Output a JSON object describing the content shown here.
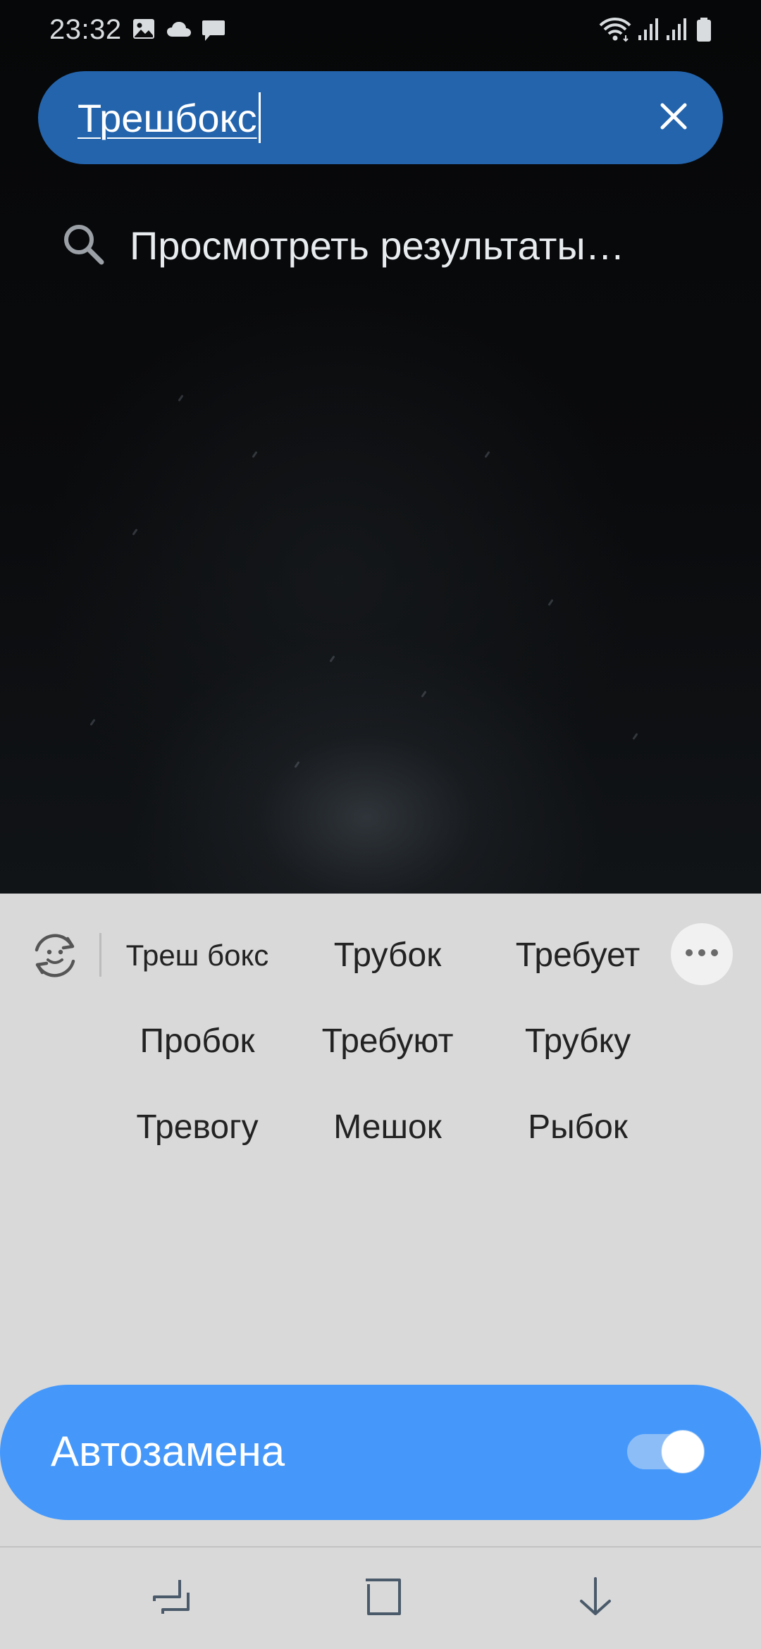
{
  "status_bar": {
    "time": "23:32",
    "left_icons": [
      "gallery-icon",
      "cloud-icon",
      "message-icon"
    ],
    "right_icons": [
      "wifi-icon",
      "signal-icon",
      "signal-icon",
      "battery-icon"
    ]
  },
  "search": {
    "query": "Трешбокс",
    "clear_icon": "close-icon"
  },
  "results": {
    "label": "Просмотреть результаты…",
    "icon": "search-icon"
  },
  "suggestions": {
    "rows": [
      [
        "Треш бокс",
        "Трубок",
        "Требует"
      ],
      [
        "Пробок",
        "Требуют",
        "Трубку"
      ],
      [
        "Тревогу",
        "Мешок",
        "Рыбок"
      ]
    ],
    "emoji_icon": "emoji-refresh-icon",
    "more_icon": "more-icon"
  },
  "autocorrect": {
    "label": "Автозамена",
    "enabled": true
  },
  "nav": {
    "icons": [
      "recents-icon",
      "home-icon",
      "hide-keyboard-icon"
    ]
  },
  "colors": {
    "search_bar": "#2364ad",
    "panel": "#d9d9d9",
    "autocorrect_pill": "#4598fa",
    "toggle_track": "#8dbdf7"
  }
}
